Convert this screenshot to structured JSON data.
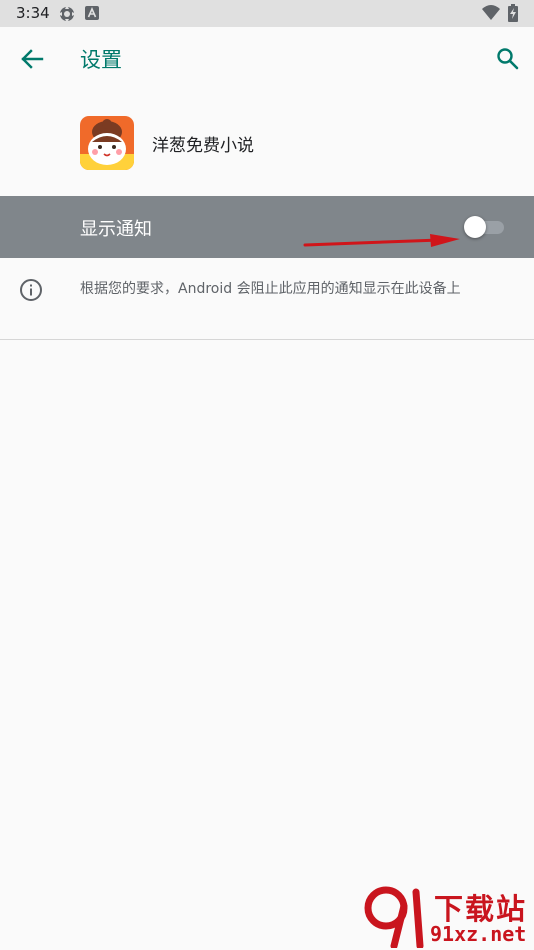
{
  "status_bar": {
    "time": "3:34",
    "icons": [
      "settings-gear-status-icon",
      "a-badge-status-icon",
      "wifi-icon",
      "battery-charging-icon"
    ]
  },
  "app_bar": {
    "title": "设置",
    "back_icon": "arrow-back-icon",
    "search_icon": "search-icon",
    "accent_color": "#00796b"
  },
  "app_info": {
    "name": "洋葱免费小说",
    "icon": "app-icon"
  },
  "notification_setting": {
    "label": "显示通知",
    "enabled": false,
    "row_color": "#80868b"
  },
  "info": {
    "icon": "info-icon",
    "text": "根据您的要求，Android 会阻止此应用的通知显示在此设备上"
  },
  "watermark": {
    "title": "下载站",
    "domain": "91xz.net",
    "color": "#c9151e"
  },
  "annotation": {
    "type": "red-arrow-pointing-to-toggle",
    "color": "#d0151a"
  }
}
